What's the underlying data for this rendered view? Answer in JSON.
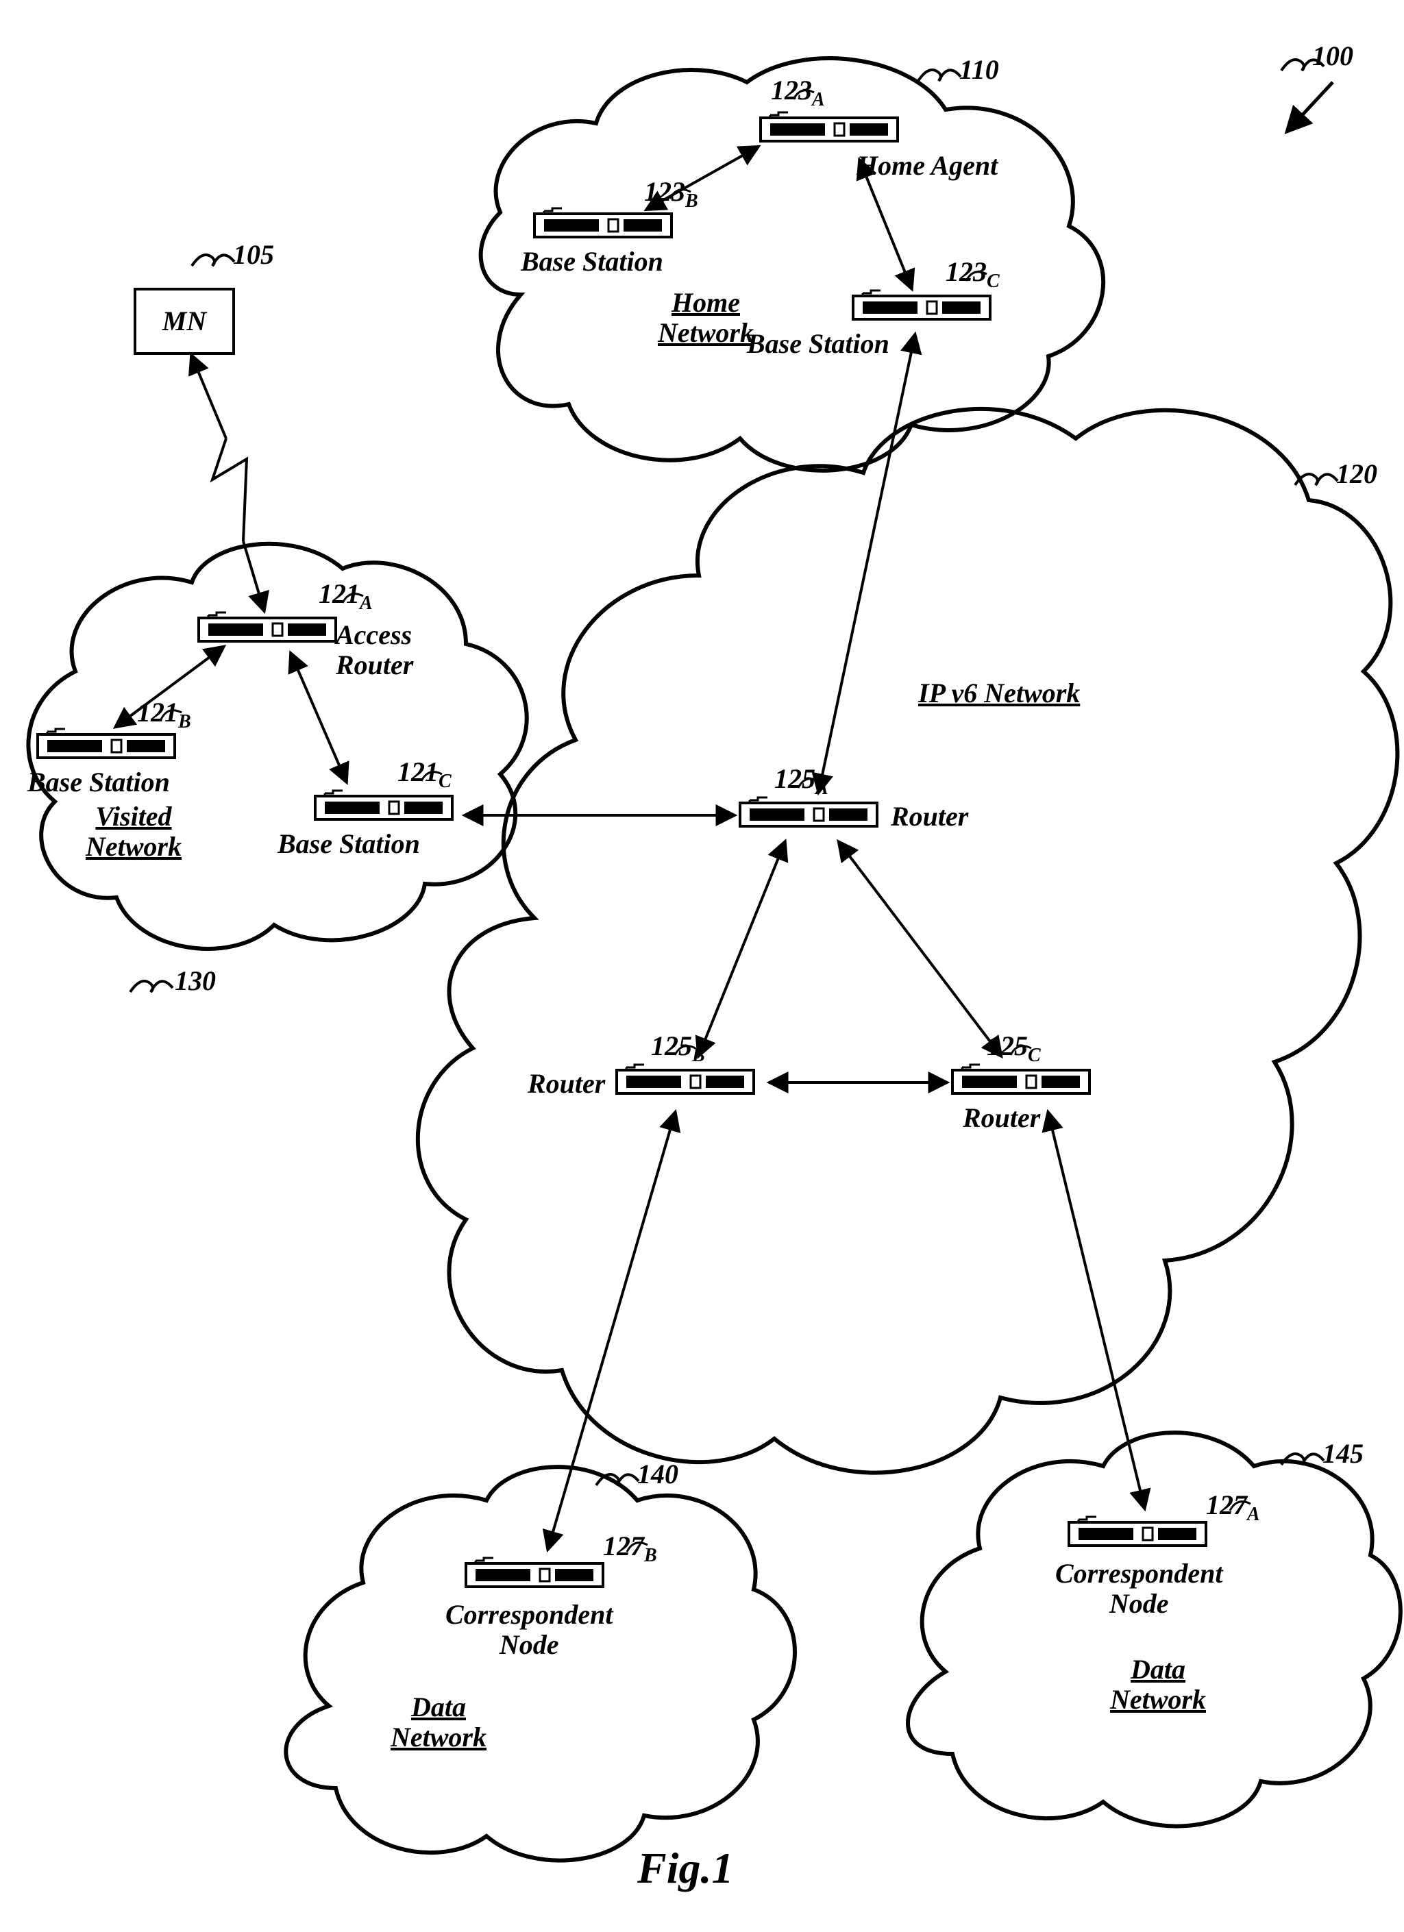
{
  "figure_caption": "Fig.1",
  "refs": {
    "r100": "100",
    "r110": "110",
    "r105": "105",
    "r120": "120",
    "r130": "130",
    "r140": "140",
    "r145": "145"
  },
  "mn_label": "MN",
  "home_network": {
    "ref123A": "123",
    "subA": "A",
    "labelA": "Home Agent",
    "ref123B": "123",
    "subB": "B",
    "labelB": "Base Station",
    "ref123C": "123",
    "subC": "C",
    "labelC": "Base Station",
    "title_l1": "Home",
    "title_l2": "Network"
  },
  "visited_network": {
    "ref121A": "121",
    "subA": "A",
    "labelA_l1": "Access",
    "labelA_l2": "Router",
    "ref121B": "121",
    "subB": "B",
    "labelB": "Base Station",
    "ref121C": "121",
    "subC": "C",
    "labelC": "Base Station",
    "title_l1": "Visited",
    "title_l2": "Network"
  },
  "ip_network": {
    "title": "IP v6 Network",
    "ref125A": "125",
    "subA": "A",
    "labelA": "Router",
    "ref125B": "125",
    "subB": "B",
    "labelB": "Router",
    "ref125C": "125",
    "subC": "C",
    "labelC": "Router"
  },
  "data_net_1": {
    "ref127B": "127",
    "subB": "B",
    "label_l1": "Correspondent",
    "label_l2": "Node",
    "title_l1": "Data",
    "title_l2": "Network"
  },
  "data_net_2": {
    "ref127A": "127",
    "subA": "A",
    "label_l1": "Correspondent",
    "label_l2": "Node",
    "title_l1": "Data",
    "title_l2": "Network"
  }
}
